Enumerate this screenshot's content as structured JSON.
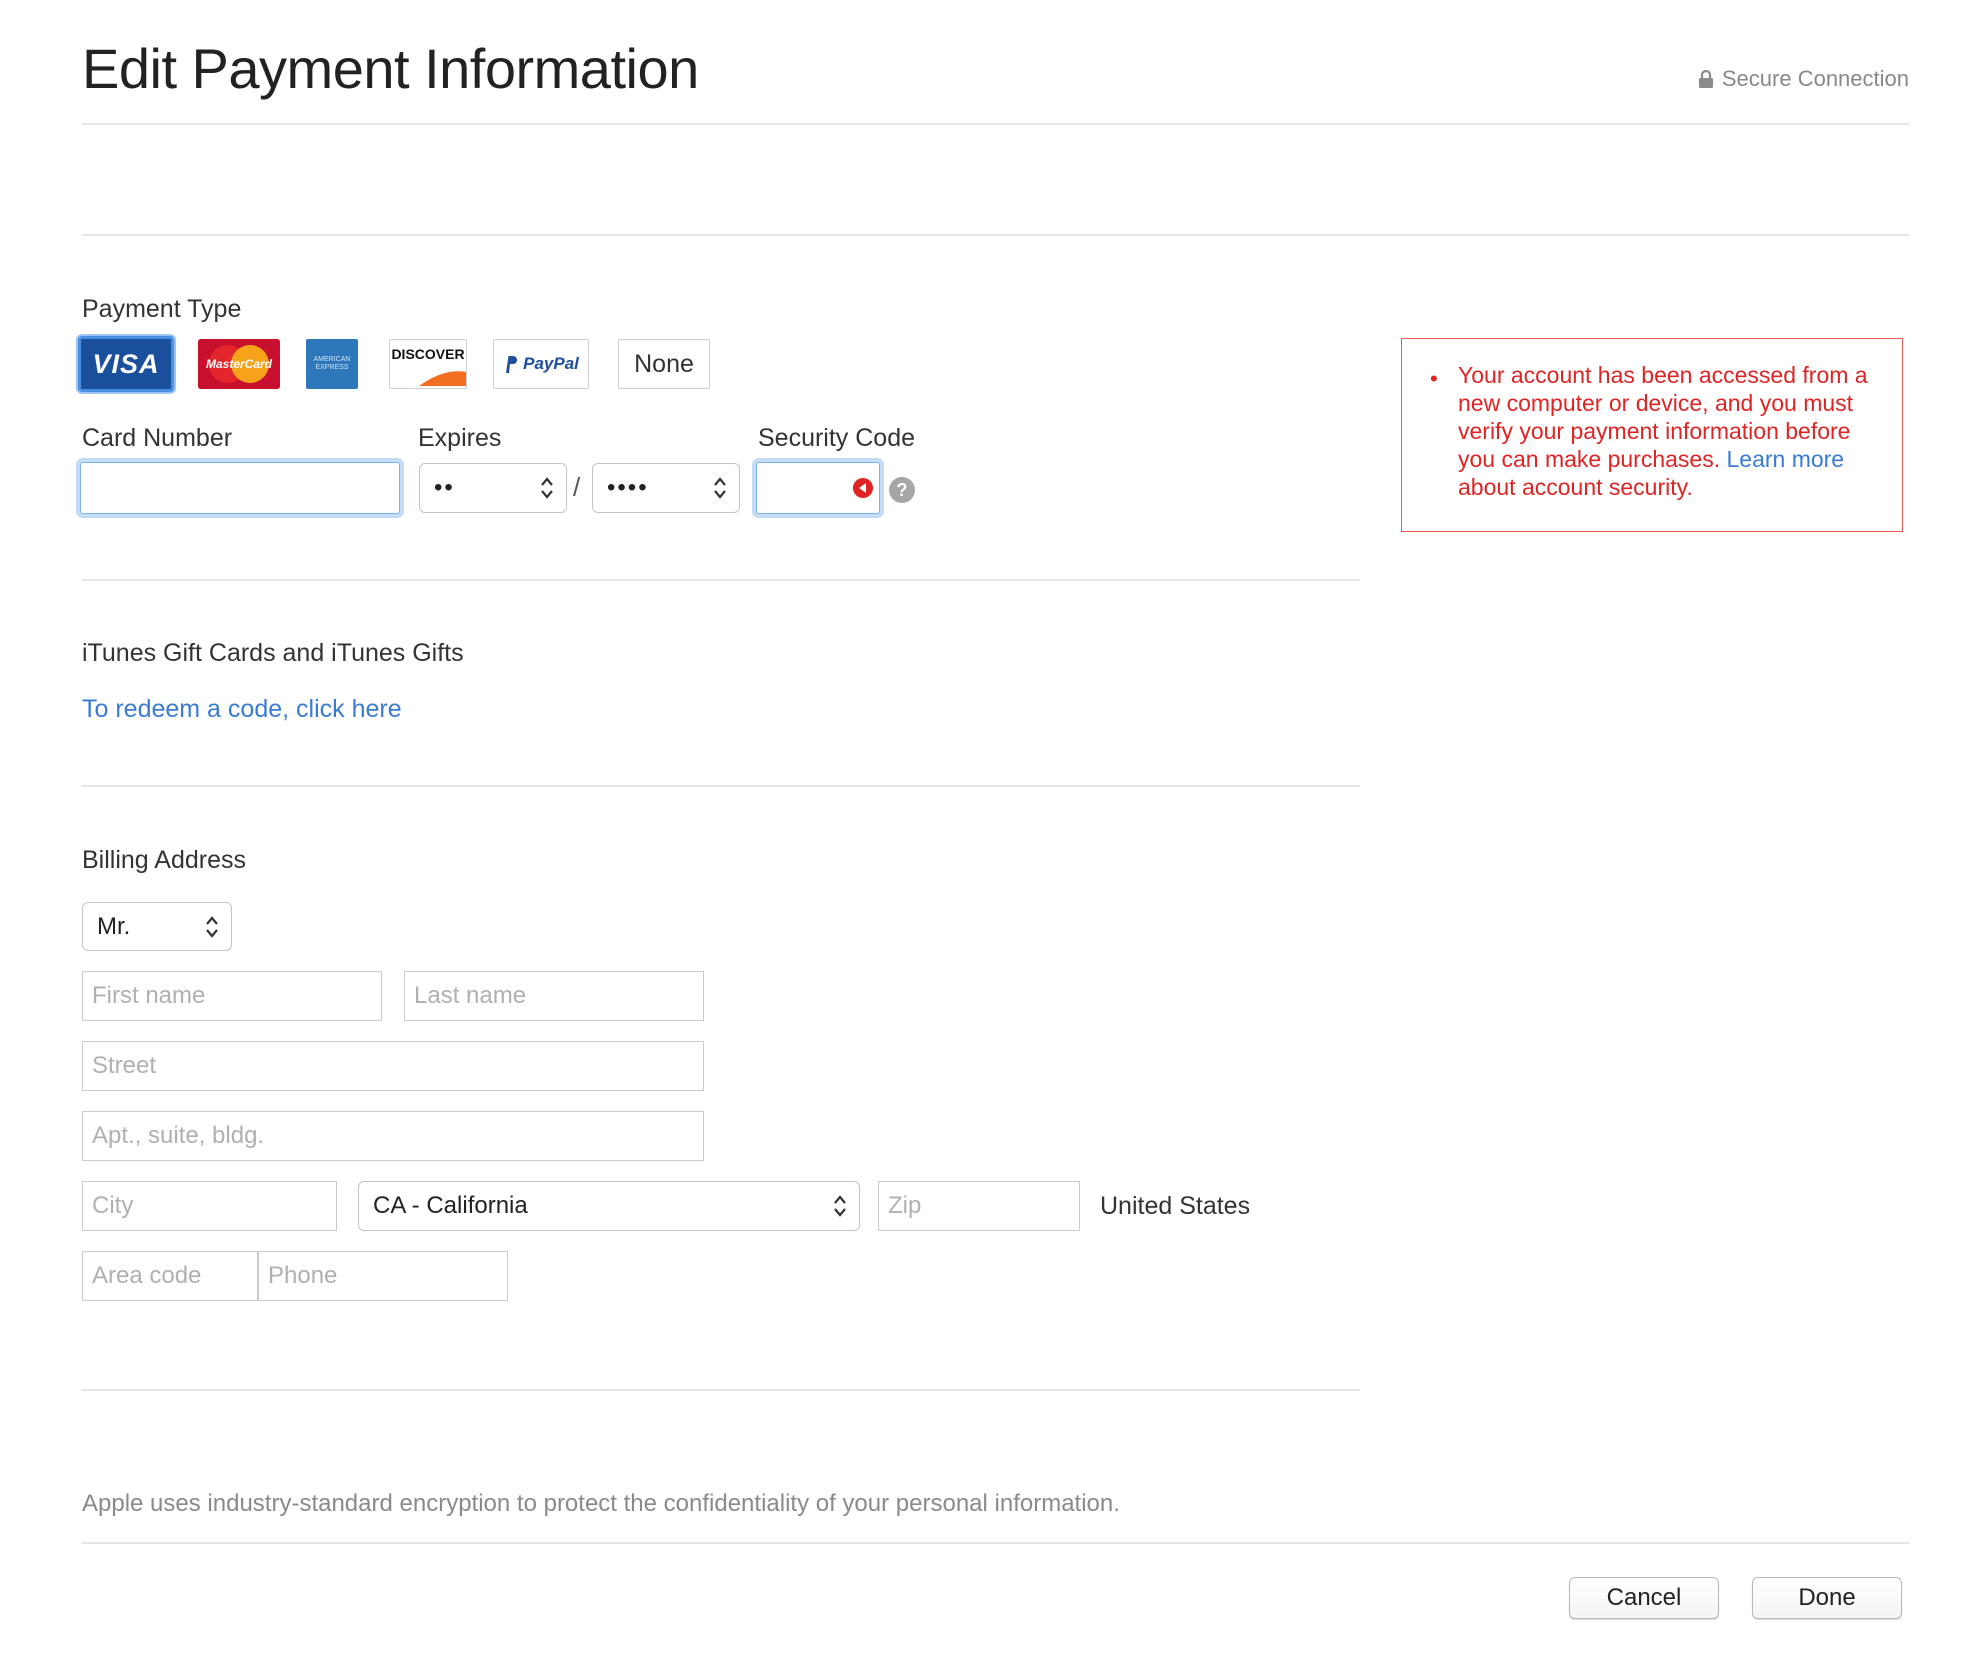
{
  "header": {
    "title": "Edit Payment Information",
    "secure_label": "Secure Connection"
  },
  "payment": {
    "section_label": "Payment Type",
    "cards": [
      {
        "label": "VISA"
      },
      {
        "label": "MasterCard"
      },
      {
        "label": "AMERICAN EXPRESS"
      },
      {
        "label": "DISCOVER"
      },
      {
        "label": "PayPal"
      },
      {
        "label": "None"
      }
    ],
    "selected_card": "VISA",
    "card_number_label": "Card Number",
    "expires_label": "Expires",
    "expires_month_value": "••",
    "expires_separator": "/",
    "expires_year_value": "••••",
    "security_code_label": "Security Code"
  },
  "alert": {
    "message": "Your account has been accessed from a new computer or device, and you must verify your payment information before you can make purchases.",
    "link_text": "Learn more",
    "suffix": "about account security."
  },
  "gifts": {
    "section_label": "iTunes Gift Cards and iTunes Gifts",
    "redeem_link": "To redeem a code, click here"
  },
  "billing": {
    "section_label": "Billing Address",
    "salutation": "Mr.",
    "first_name_placeholder": "First name",
    "last_name_placeholder": "Last name",
    "street_placeholder": "Street",
    "apt_placeholder": "Apt., suite, bldg.",
    "city_placeholder": "City",
    "state": "CA - California",
    "zip_placeholder": "Zip",
    "country": "United States",
    "area_code_placeholder": "Area code",
    "phone_placeholder": "Phone"
  },
  "footer": {
    "note": "Apple uses industry-standard encryption to protect the confidentiality of your personal information.",
    "cancel_label": "Cancel",
    "done_label": "Done"
  },
  "colors": {
    "link": "#3a7bd5",
    "error": "#e02424",
    "focus": "#7fb2ea",
    "visa_blue": "#1a4f9c"
  }
}
